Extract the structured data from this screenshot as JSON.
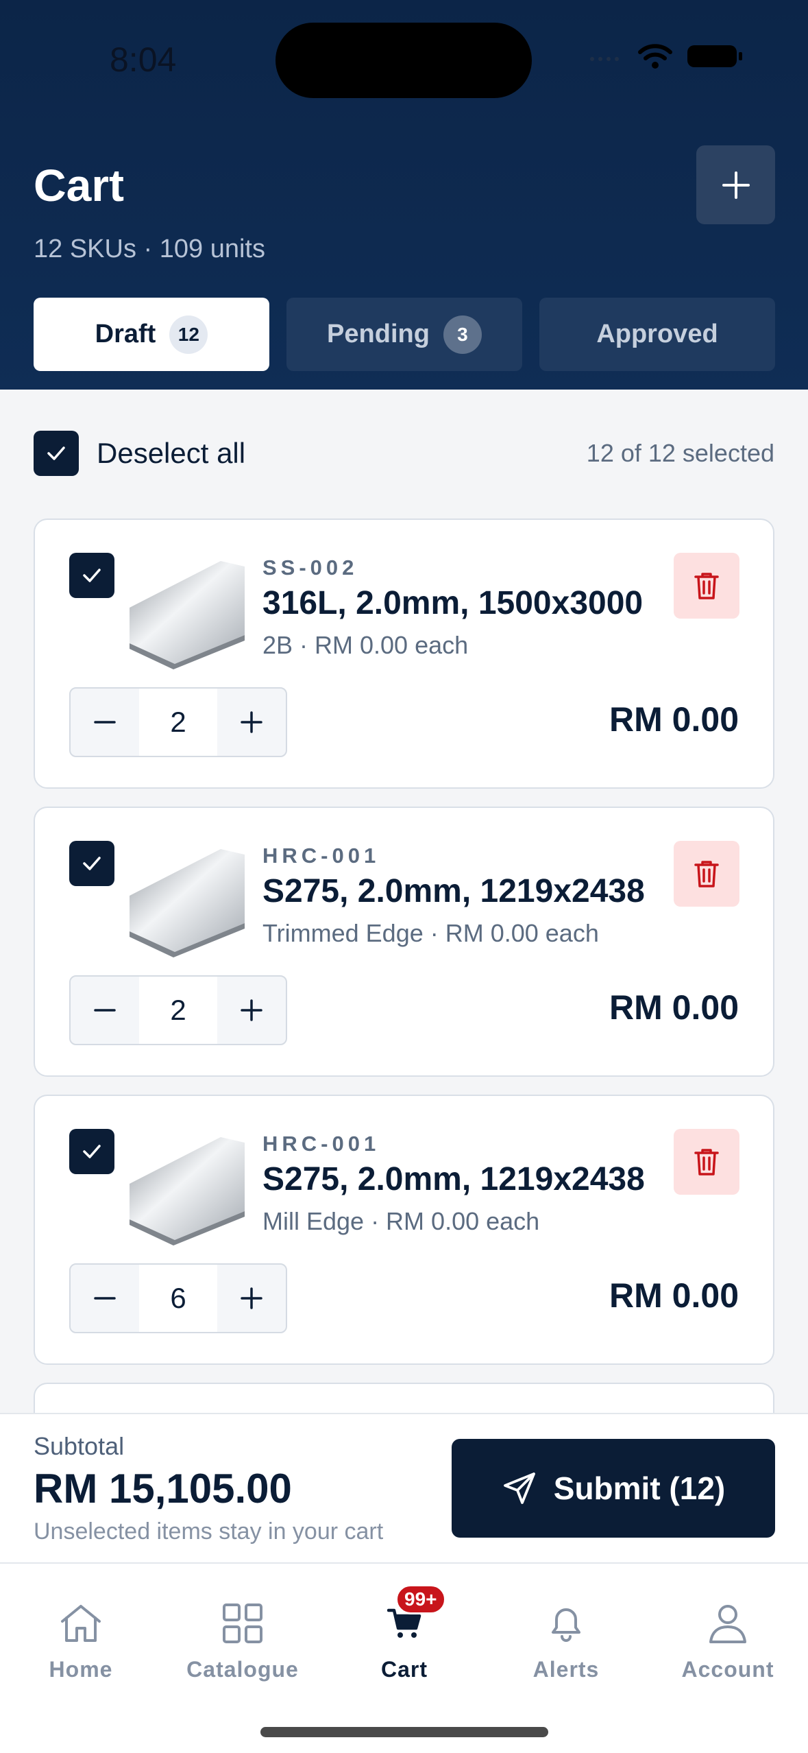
{
  "status": {
    "time": "8:04"
  },
  "header": {
    "title": "Cart",
    "subtitle": "12 SKUs · 109 units",
    "tabs": [
      {
        "label": "Draft",
        "badge": "12"
      },
      {
        "label": "Pending",
        "badge": "3"
      },
      {
        "label": "Approved"
      }
    ]
  },
  "selection": {
    "label": "Deselect all",
    "count_text": "12 of 12 selected"
  },
  "items": [
    {
      "sku": "SS-002",
      "name": "316L, 2.0mm, 1500x3000",
      "desc": "2B · RM 0.00 each",
      "qty": "2",
      "total": "RM 0.00"
    },
    {
      "sku": "HRC-001",
      "name": "S275, 2.0mm, 1219x2438",
      "desc": "Trimmed Edge · RM 0.00 each",
      "qty": "2",
      "total": "RM 0.00"
    },
    {
      "sku": "HRC-001",
      "name": "S275, 2.0mm, 1219x2438",
      "desc": "Mill Edge · RM 0.00 each",
      "qty": "6",
      "total": "RM 0.00"
    }
  ],
  "footer": {
    "subtitle_label": "Subtotal",
    "subtotal": "RM 15,105.00",
    "note": "Unselected items stay in your cart",
    "submit_label": "Submit (12)"
  },
  "nav": {
    "items": [
      {
        "label": "Home",
        "icon": "home-icon"
      },
      {
        "label": "Catalogue",
        "icon": "grid-icon"
      },
      {
        "label": "Cart",
        "icon": "cart-icon",
        "badge": "99+"
      },
      {
        "label": "Alerts",
        "icon": "bell-icon"
      },
      {
        "label": "Account",
        "icon": "user-icon"
      }
    ]
  },
  "colors": {
    "navy": "#0b1d36",
    "header": "#0c2548",
    "danger": "#c8151b",
    "danger_bg": "#fde0e0"
  }
}
